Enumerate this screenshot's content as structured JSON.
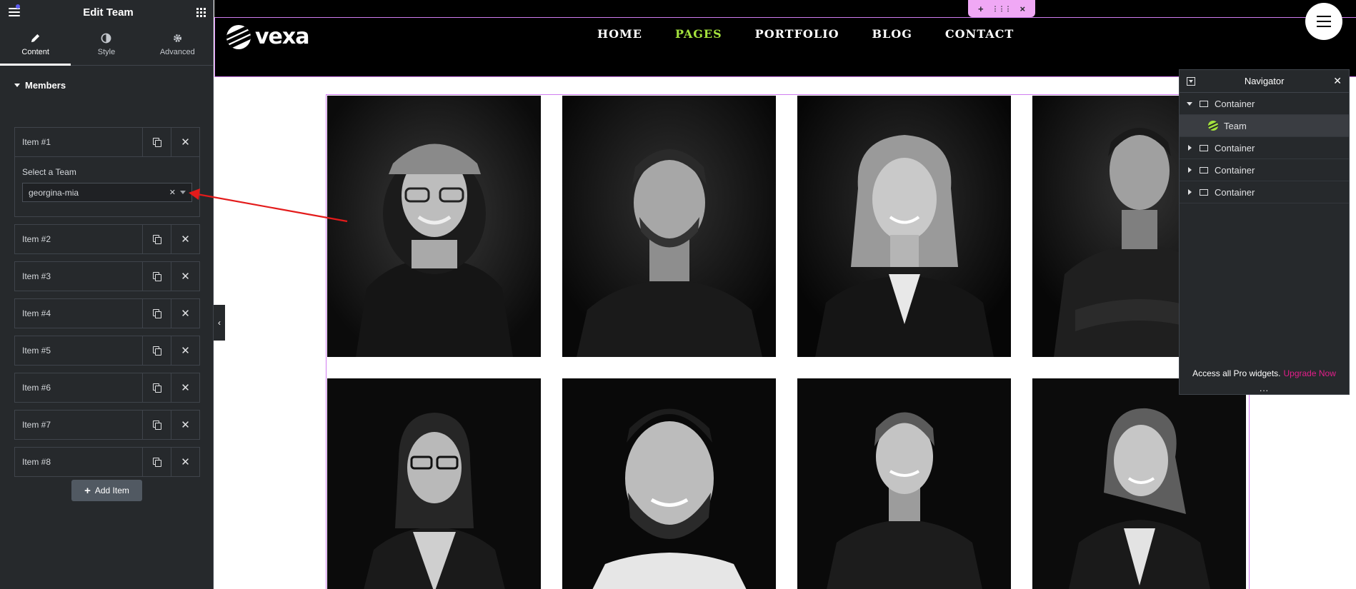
{
  "panel": {
    "title": "Edit Team",
    "tabs": [
      {
        "label": "Content",
        "icon": "pencil-icon",
        "active": true
      },
      {
        "label": "Style",
        "icon": "contrast-icon",
        "active": false
      },
      {
        "label": "Advanced",
        "icon": "gear-icon",
        "active": false
      }
    ],
    "section_title": "Members",
    "items": [
      {
        "label": "Item #1",
        "open": true
      },
      {
        "label": "Item #2"
      },
      {
        "label": "Item #3"
      },
      {
        "label": "Item #4"
      },
      {
        "label": "Item #5"
      },
      {
        "label": "Item #6"
      },
      {
        "label": "Item #7"
      },
      {
        "label": "Item #8"
      }
    ],
    "select_team_label": "Select a Team",
    "select_team_value": "georgina-mia",
    "add_item_label": "Add Item"
  },
  "site": {
    "logo_text": "vexa",
    "nav": [
      {
        "label": "HOME",
        "active": false
      },
      {
        "label": "PAGES",
        "active": true
      },
      {
        "label": "PORTFOLIO",
        "active": false
      },
      {
        "label": "BLOG",
        "active": false
      },
      {
        "label": "CONTACT",
        "active": false
      }
    ],
    "edit_handle": {
      "add": "+",
      "move": "⋮⋮⋮",
      "close": "×"
    },
    "accent_color": "#a4e23d",
    "team_photos": [
      "woman-new-york-cap",
      "bearded-man-tshirt",
      "blonde-woman-blazer",
      "man-dark-jacket",
      "woman-glasses",
      "smiling-bearded-man",
      "young-man-shirt",
      "woman-ponytail-blazer"
    ]
  },
  "navigator": {
    "title": "Navigator",
    "rows": [
      {
        "label": "Container",
        "expanded": true
      },
      {
        "label": "Team",
        "child": true
      },
      {
        "label": "Container",
        "expanded": false
      },
      {
        "label": "Container",
        "expanded": false
      },
      {
        "label": "Container",
        "expanded": false
      }
    ],
    "footer_text": "Access all Pro widgets.",
    "upgrade_label": "Upgrade Now",
    "more_label": "..."
  }
}
